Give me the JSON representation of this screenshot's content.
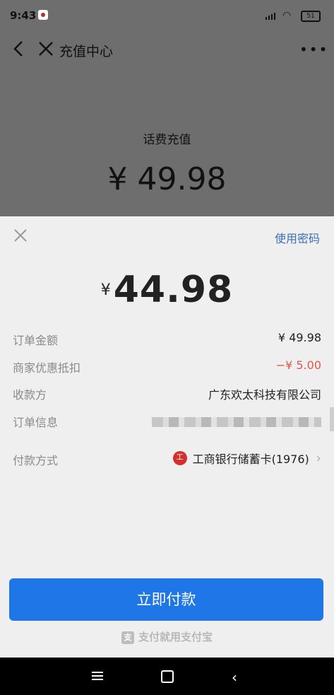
{
  "status_bar": {
    "time": "9:43",
    "battery": "51"
  },
  "nav": {
    "title": "充值中心",
    "more": "•••"
  },
  "order": {
    "name": "话费充值",
    "total": "¥ 49.98"
  },
  "sheet": {
    "use_password": "使用密码",
    "currency": "¥",
    "pay_amount": "44.98",
    "rows": [
      {
        "label": "订单金额",
        "value": "¥ 49.98"
      },
      {
        "label": "商家优惠抵扣",
        "value": "−¥ 5.00"
      },
      {
        "label": "收款方",
        "value": "广东欢太科技有限公司"
      },
      {
        "label": "订单信息"
      }
    ],
    "payment_method": {
      "label": "付款方式",
      "bank": "工商银行储蓄卡(1976)"
    },
    "pay_button": "立即付款",
    "brand": "支付就用支付宝"
  },
  "colors": {
    "accent": "#1f76e6",
    "discount": "#e0574b",
    "link": "#3c6fb3"
  }
}
